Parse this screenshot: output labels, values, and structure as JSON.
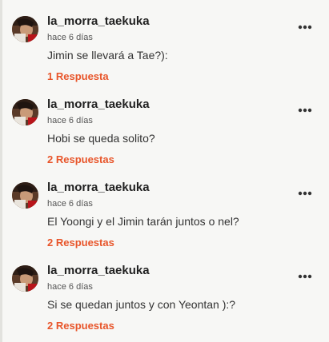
{
  "colors": {
    "background": "#f7f7f5",
    "replies_link": "#e8552a",
    "username": "#222222",
    "body_text": "#333333",
    "timestamp": "#555555"
  },
  "comments": [
    {
      "username": "la_morra_taekuka",
      "timestamp": "hace 6 días",
      "text": "Jimin se llevará a Tae?):",
      "replies": "1 Respuesta",
      "more_icon": "more-dots-icon"
    },
    {
      "username": "la_morra_taekuka",
      "timestamp": "hace 6 días",
      "text": "Hobi se queda solito?",
      "replies": "2 Respuestas",
      "more_icon": "more-dots-icon"
    },
    {
      "username": "la_morra_taekuka",
      "timestamp": "hace 6 días",
      "text": "El Yoongi y el Jimin tarán juntos o nel?",
      "replies": "2 Respuestas",
      "more_icon": "more-dots-icon"
    },
    {
      "username": "la_morra_taekuka",
      "timestamp": "hace 6 días",
      "text": "Si se quedan juntos y con Yeontan ):?",
      "replies": "2 Respuestas",
      "more_icon": "more-dots-icon"
    }
  ]
}
